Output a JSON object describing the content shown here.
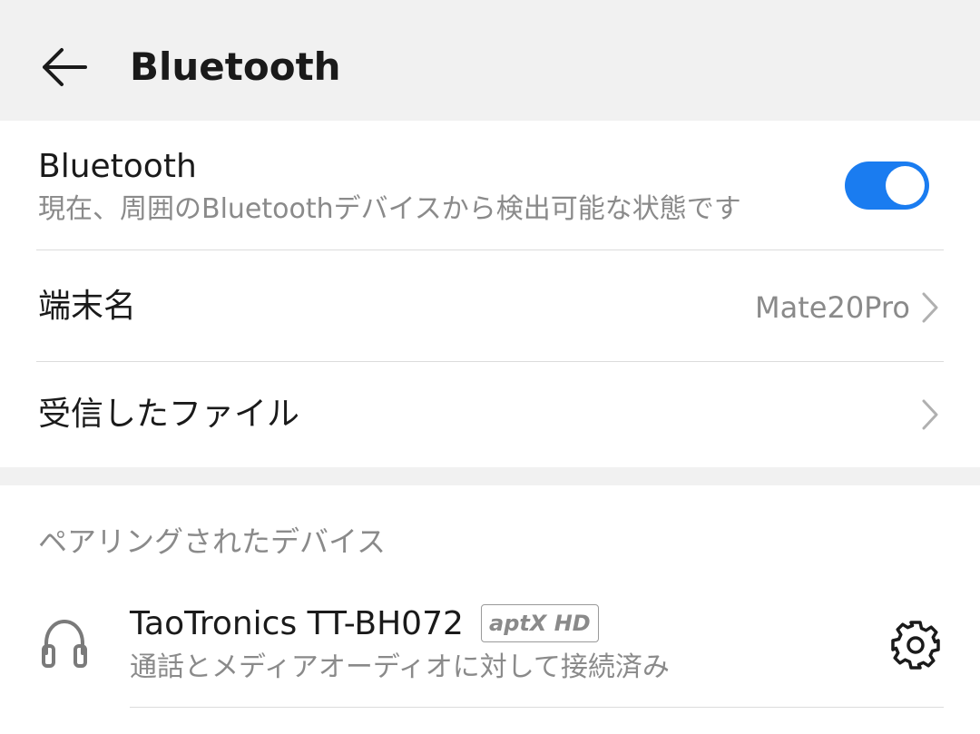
{
  "header": {
    "title": "Bluetooth",
    "back_icon": "arrow-left-icon"
  },
  "bluetooth_toggle": {
    "title": "Bluetooth",
    "subtitle": "現在、周囲のBluetoothデバイスから検出可能な状態です",
    "enabled": true,
    "accent_color": "#1a7cf0"
  },
  "device_name_row": {
    "label": "端末名",
    "value": "Mate20Pro"
  },
  "received_files_row": {
    "label": "受信したファイル"
  },
  "paired_section": {
    "header": "ペアリングされたデバイス",
    "devices": [
      {
        "name": "TaoTronics TT-BH072",
        "codec": "aptX HD",
        "status": "通話とメディアオーディオに対して接続済み",
        "icon": "headphones-icon",
        "settings_icon": "gear-icon"
      }
    ]
  }
}
